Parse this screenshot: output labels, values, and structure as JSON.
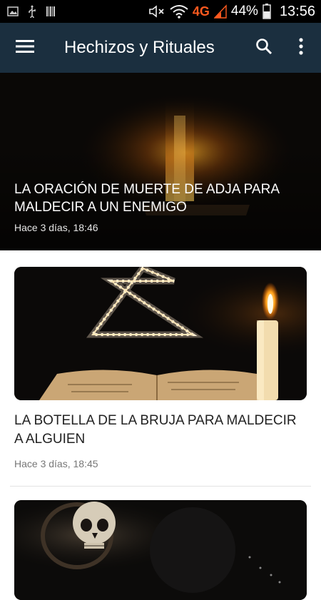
{
  "status_bar": {
    "network_type": "4G",
    "battery_percent": "44%",
    "time": "13:56",
    "icons": [
      "image-notification-icon",
      "usb-icon",
      "barcode-icon",
      "mute-icon",
      "wifi-icon",
      "signal-icon",
      "battery-icon"
    ]
  },
  "app_bar": {
    "title": "Hechizos y Rituales",
    "icons": [
      "menu-icon",
      "search-icon",
      "more-vert-icon"
    ]
  },
  "hero": {
    "title": "LA ORACIÓN DE MUERTE DE ADJA PARA MALDECIR A UN ENEMIGO",
    "date": "Hace 3 días, 18:46"
  },
  "articles": [
    {
      "title": "LA BOTELLA DE LA BRUJA PARA MALDECIR A ALGUIEN",
      "date": "Hace 3 días, 18:45"
    }
  ],
  "colors": {
    "app_bar": "#1b2f3f",
    "status_bar": "#000000",
    "network_accent": "#ff5a1f"
  }
}
